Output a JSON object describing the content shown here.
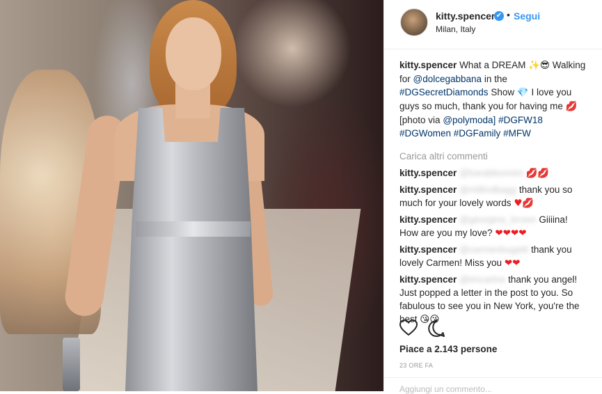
{
  "post": {
    "username": "kitty.spencer",
    "verified_mark": "✔",
    "separator": "•",
    "follow_label": "Segui",
    "location": "Milan, Italy"
  },
  "caption": {
    "username": "kitty.spencer",
    "text1": "What a DREAM",
    "emoji1": "✨😎",
    "text2": "Walking for",
    "mention1": "@dolcegabbana",
    "text3": "in the",
    "hashtag1": "#DGSecretDiamonds",
    "text4": "Show",
    "emoji2": "💎",
    "text5": "I love you guys so much, thank you for having me",
    "emoji3": "💋",
    "text6": "[photo via",
    "mention2": "@polymoda]",
    "hashtag2": "#DGFW18",
    "hashtag3": "#DGWomen",
    "hashtag4": "#DGFamily",
    "hashtag5": "#MFW"
  },
  "load_more_label": "Carica altri commenti",
  "comments": [
    {
      "username": "kitty.spencer",
      "mention": "@barabbonnini",
      "text": "",
      "emoji": "💋💋"
    },
    {
      "username": "kitty.spencer",
      "mention": "@millindbagg",
      "text": "thank you so much for your lovely words",
      "emoji": "♥💋"
    },
    {
      "username": "kitty.spencer",
      "mention": "@georgina_brown",
      "text": "Giiiina! How are you my love?",
      "emoji": "❤❤❤❤"
    },
    {
      "username": "kitty.spencer",
      "mention": "@carmenbugatti",
      "text": "thank you lovely Carmen! Miss you",
      "emoji": "❤❤"
    },
    {
      "username": "kitty.spencer",
      "mention": "@tmcartne",
      "text": "thank you angel! Just popped a letter in the post to you. So fabulous to see you in New York, you're the best",
      "emoji": "😘😘"
    }
  ],
  "icons": {
    "like": "heart-outline-icon",
    "comment": "comment-bubble-icon"
  },
  "likes_label": "Piace a 2.143 persone",
  "time_label": "23 ORE FA",
  "add_comment_placeholder": "Aggiungi un commento...",
  "colors": {
    "link": "#003569",
    "follow": "#3897f0",
    "muted": "#999999",
    "heart": "#ed1c24"
  }
}
